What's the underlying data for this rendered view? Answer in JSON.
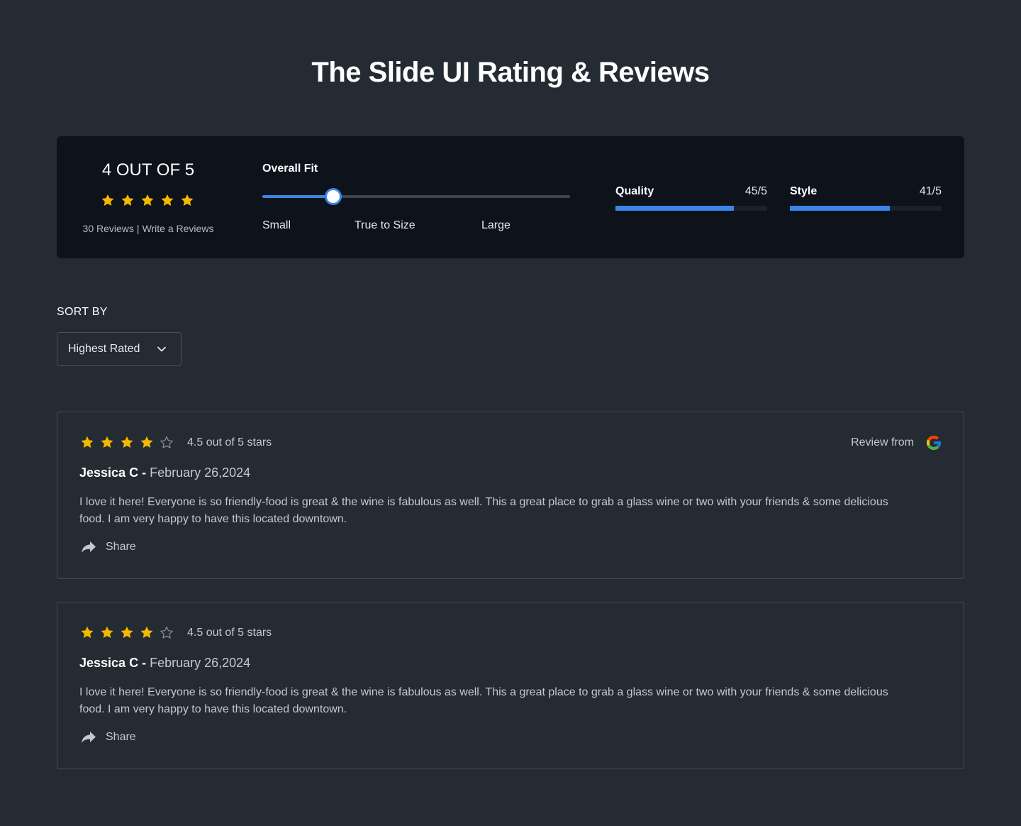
{
  "page": {
    "title": "The Slide UI Rating & Reviews"
  },
  "colors": {
    "background": "#252b33",
    "card": "#0d121b",
    "accent": "#3a85e6",
    "star": "#f5b800",
    "star_empty": "#8a9099"
  },
  "summary": {
    "score_title": "4 OUT OF 5",
    "stars": 5,
    "reviews_count_label": "30 Reviews",
    "separator": "|",
    "write_review_label": "Write a Reviews"
  },
  "fit": {
    "title": "Overall Fit",
    "value_fraction": 0.23,
    "labels": {
      "small": "Small",
      "true_to_size": "True to Size",
      "large": "Large"
    }
  },
  "metrics": {
    "quality": {
      "name": "Quality",
      "value_label": "45/5",
      "fill_fraction": 0.78
    },
    "style": {
      "name": "Style",
      "value_label": "41/5",
      "fill_fraction": 0.66
    }
  },
  "sort": {
    "label": "SORT BY",
    "selected": "Highest Rated",
    "icon": "chevron-down-icon"
  },
  "reviews": [
    {
      "filled_stars": 4,
      "total_stars": 5,
      "rating_text": "4.5 out of 5 stars",
      "source_label": "Review from",
      "source_icon": "google-icon",
      "author": "Jessica C -",
      "date": "February 26,2024",
      "body": "I love it here! Everyone is so friendly-food is great & the wine is fabulous as well. This a great place to grab a glass wine or two with your friends & some delicious food. I am very happy to have this located downtown.",
      "share_label": "Share"
    },
    {
      "filled_stars": 4,
      "total_stars": 5,
      "rating_text": "4.5 out of 5 stars",
      "author": "Jessica C -",
      "date": "February 26,2024",
      "body": "I love it here! Everyone is so friendly-food is great & the wine is fabulous as well. This a great place to grab a glass wine or two with your friends & some delicious food. I am very happy to have this located downtown.",
      "share_label": "Share"
    }
  ]
}
